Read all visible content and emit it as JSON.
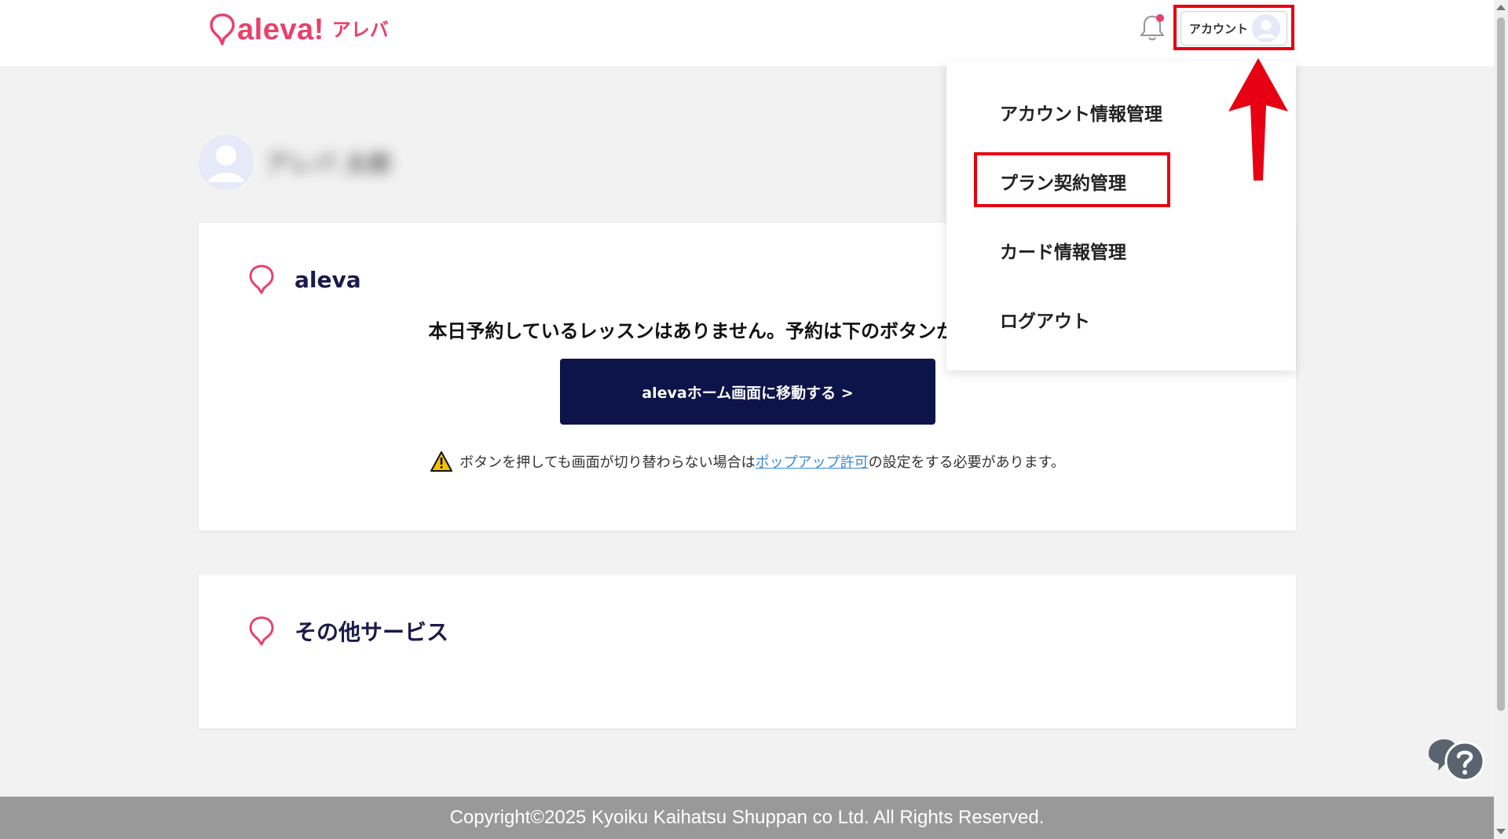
{
  "header": {
    "logo_text": "aleva!",
    "logo_kana": "アレバ",
    "bell_icon": "bell-icon",
    "account_label": "アカウント",
    "account_avatar_icon": "user-avatar-icon"
  },
  "user": {
    "name": "アレバ 太郎",
    "avatar_icon": "user-avatar-icon"
  },
  "cards": {
    "aleva": {
      "title": "aleva",
      "notice": "本日予約しているレッスンはありません。予約は下のボタンから行えます。",
      "home_button": "alevaホーム画面に移動する >",
      "warning_before": "ボタンを押しても画面が切り替わらない場合は",
      "warning_link": "ポップアップ許可",
      "warning_after": "の設定をする必要があります。"
    },
    "other": {
      "title": "その他サービス"
    }
  },
  "dropdown": {
    "items": [
      {
        "label": "アカウント情報管理"
      },
      {
        "label": "プラン契約管理"
      },
      {
        "label": "カード情報管理"
      },
      {
        "label": "ログアウト"
      }
    ]
  },
  "footer": {
    "copyright": "Copyright©2025 Kyoiku Kaihatsu Shuppan co Ltd. All Rights Reserved."
  },
  "colors": {
    "brand": "#e8416b",
    "navy": "#0c1449",
    "highlight": "#e60012",
    "link": "#3a8ad6",
    "footer_bg": "#999999"
  }
}
